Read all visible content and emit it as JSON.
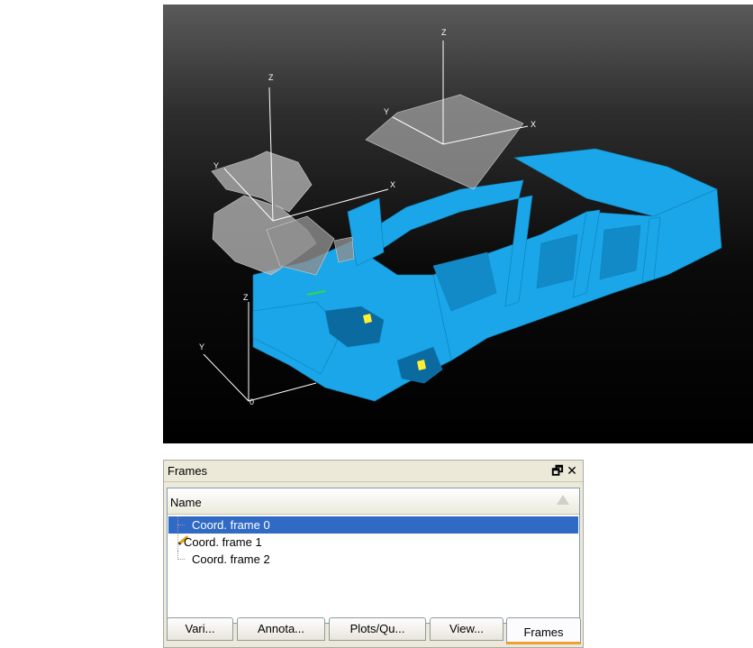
{
  "viewport": {
    "axis_labels": {
      "frame_top_z": "Z",
      "frame_top_y": "Y",
      "frame_top_x": "X",
      "frame_left_z": "Z",
      "frame_left_y": "Y",
      "frame_left_x": "X",
      "frame_base_z": "Z",
      "frame_base_y": "Y",
      "frame_base_origin": "0"
    },
    "colors": {
      "car_body": "#1aa6e8",
      "panel_gray": "#a8a8a8",
      "background": "#000000"
    }
  },
  "panel": {
    "title": "Frames",
    "float_glyph": "🗗",
    "close_glyph": "✕",
    "column_header": "Name",
    "rows": [
      {
        "label": "Coord. frame 0",
        "selected": true
      },
      {
        "label": "Coord. frame 1",
        "selected": false,
        "icon": "pencil-icon"
      },
      {
        "label": "Coord. frame 2",
        "selected": false
      }
    ],
    "tabs": [
      {
        "label": "Vari..."
      },
      {
        "label": "Annota..."
      },
      {
        "label": "Plots/Qu..."
      },
      {
        "label": "View..."
      },
      {
        "label": "Frames",
        "active": true
      }
    ]
  }
}
